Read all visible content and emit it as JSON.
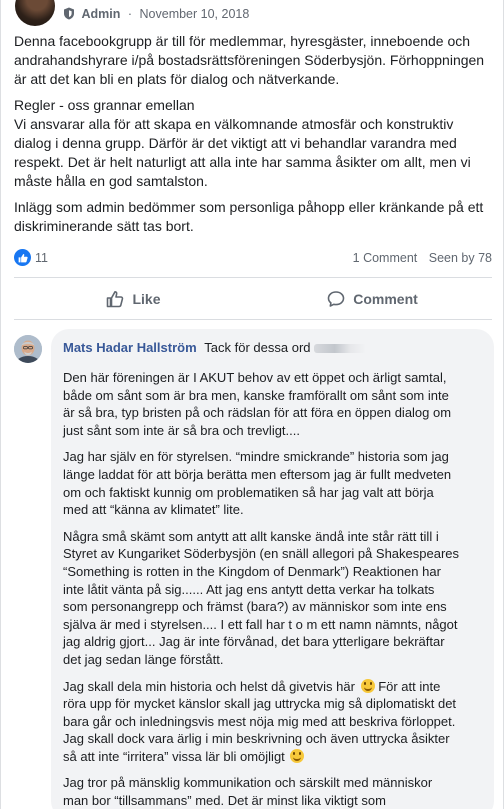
{
  "post": {
    "role": "Admin",
    "date": "November 10, 2018",
    "paragraphs": [
      "Denna facebookgrupp är till för medlemmar, hyresgäster, inneboende och andrahandshyrare i/på bostadsrättsföreningen Söderbysjön. Förhoppningen är att det kan bli en plats för dialog och nätverkande.",
      "Regler - oss grannar emellan\nVi ansvarar alla för att skapa en välkomnande atmosfär och konstruktiv dialog i denna grupp. Därför är det viktigt att vi behandlar varandra med respekt. Det är helt naturligt att alla inte har samma åsikter om allt, men vi måste hålla en god samtalston.",
      "Inlägg som admin bedömmer som personliga påhopp eller kränkande på ett diskriminerande sätt tas bort."
    ],
    "reactions_count": "11",
    "comments_count": "1 Comment",
    "seen_by": "Seen by 78",
    "actions": {
      "like": "Like",
      "comment": "Comment"
    }
  },
  "comment": {
    "author": "Mats Hadar Hallström",
    "first_line": "Tack för dessa ord",
    "paragraphs": [
      "Den här föreningen är I AKUT behov av ett öppet och ärligt samtal, både om sånt som är bra men, kanske framförallt om sånt som inte är så bra, typ bristen på och rädslan för att föra en öppen dialog om just sånt som inte är så bra och trevligt....",
      "Jag har själv en för styrelsen. “mindre smickrande” historia som jag länge laddat för att börja berätta men eftersom jag är fullt medveten om och faktiskt kunnig om problematiken så har jag valt att börja med att “känna av klimatet” lite.",
      "Några små skämt som antytt att allt kanske ändå inte står rätt till i Styret av Kungariket Söderbysjön (en snäll allegori på Shakespeares “Something is rotten in the Kingdom of Denmark”) Reaktionen har inte låtit vänta på sig...... Att jag ens antytt detta verkar ha tolkats som personangrepp och främst (bara?) av människor som inte ens själva är med i styrelsen.... I ett fall har t o m ett namn nämnts, något jag aldrig gjort... Jag är inte förvånad, det bara ytterligare bekräftar det jag sedan länge förstått.",
      "Jag skall dela min historia och helst då givetvis här",
      "För att inte röra upp för mycket känslor skall jag uttrycka mig så diplomatiskt det bara går och inledningsvis mest nöja mig med att beskriva förloppet. Jag skall dock vara ärlig i min beskrivning och även uttrycka åsikter så att inte “irritera” vissa lär bli omöjligt",
      "Jag tror på mänsklig kommunikation och särskilt med människor man bor “tillsammans” med. Det är minst lika viktigt som sjutillhållarlås och mycket viktigare än strikta ordningsregler, paragrafer och en perfekt fasad...."
    ]
  }
}
